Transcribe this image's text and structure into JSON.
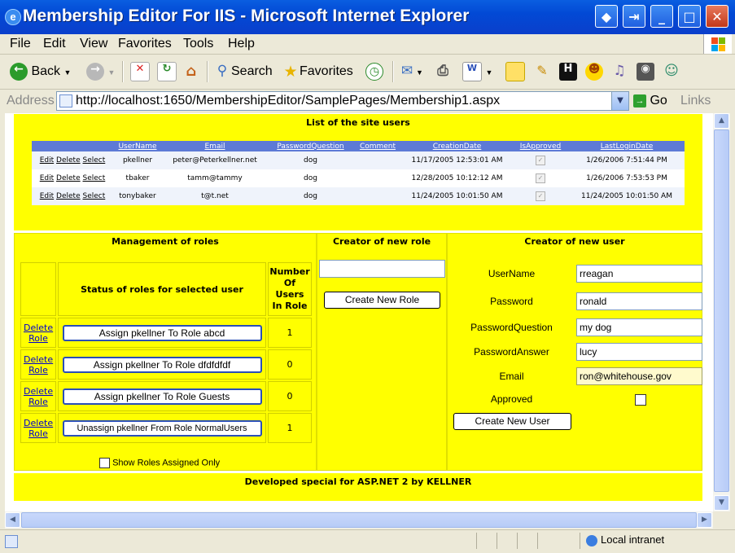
{
  "window": {
    "title": "Membership Editor For IIS - Microsoft Internet Explorer"
  },
  "menu": [
    "File",
    "Edit",
    "View",
    "Favorites",
    "Tools",
    "Help"
  ],
  "toolbar": {
    "back": "Back",
    "search": "Search",
    "favorites": "Favorites"
  },
  "address": {
    "label": "Address",
    "url": "http://localhost:1650/MembershipEditor/SamplePages/Membership1.aspx",
    "go": "Go",
    "links": "Links"
  },
  "users_section": {
    "title": "List of the site users",
    "columns": [
      "UserName",
      "Email",
      "PasswordQuestion",
      "Comment",
      "CreationDate",
      "IsApproved",
      "LastLoginDate"
    ],
    "row_actions": [
      "Edit",
      "Delete",
      "Select"
    ],
    "rows": [
      {
        "username": "pkellner",
        "email": "peter@Peterkellner.net",
        "question": "dog",
        "comment": "",
        "created": "11/17/2005 12:53:01 AM",
        "approved": true,
        "lastlogin": "1/26/2006 7:51:44 PM"
      },
      {
        "username": "tbaker",
        "email": "tamm@tammy",
        "question": "dog",
        "comment": "",
        "created": "12/28/2005 10:12:12 AM",
        "approved": true,
        "lastlogin": "1/26/2006 7:53:53 PM"
      },
      {
        "username": "tonybaker",
        "email": "t@t.net",
        "question": "dog",
        "comment": "",
        "created": "11/24/2005 10:01:50 AM",
        "approved": true,
        "lastlogin": "11/24/2005 10:01:50 AM"
      }
    ]
  },
  "roles_section": {
    "title": "Management of roles",
    "col_status": "Status of roles for selected user",
    "col_count": "Number Of Users In Role",
    "delete_label": "Delete Role",
    "rows": [
      {
        "button": "Assign pkellner To Role abcd",
        "count": "1"
      },
      {
        "button": "Assign pkellner To Role dfdfdfdf",
        "count": "0"
      },
      {
        "button": "Assign pkellner To Role Guests",
        "count": "0"
      },
      {
        "button": "Unassign pkellner From Role NormalUsers",
        "count": "1"
      }
    ],
    "show_assigned_only": "Show Roles Assigned Only"
  },
  "new_role": {
    "title": "Creator of new role",
    "value": "",
    "button": "Create New Role"
  },
  "new_user": {
    "title": "Creator of new user",
    "fields": [
      {
        "label": "UserName",
        "value": "rreagan"
      },
      {
        "label": "Password",
        "value": "ronald"
      },
      {
        "label": "PasswordQuestion",
        "value": "my dog"
      },
      {
        "label": "PasswordAnswer",
        "value": "lucy"
      },
      {
        "label": "Email",
        "value": "ron@whitehouse.gov"
      }
    ],
    "approved_label": "Approved",
    "button": "Create New User"
  },
  "footer": "Developed special for ASP.NET 2 by KELLNER",
  "status": {
    "zone": "Local intranet"
  }
}
